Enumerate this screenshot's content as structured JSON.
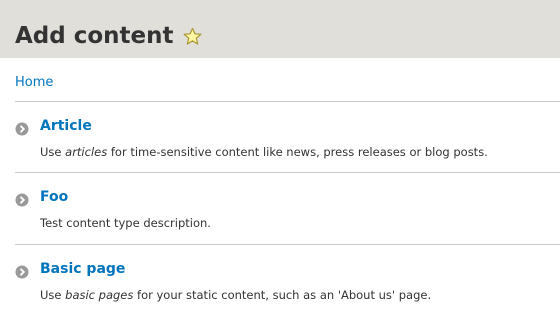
{
  "header": {
    "title": "Add content",
    "shortcut_icon": "star-icon",
    "background": "#e0dfd9"
  },
  "breadcrumb": {
    "home": "Home"
  },
  "link_color": "#0074bd",
  "content_types": [
    {
      "label": "Article",
      "description_before": "Use ",
      "description_em": "articles",
      "description_after": " for time-sensitive content like news, press releases or blog posts."
    },
    {
      "label": "Foo",
      "description_before": "Test content type description.",
      "description_em": "",
      "description_after": ""
    },
    {
      "label": "Basic page",
      "description_before": "Use ",
      "description_em": "basic pages",
      "description_after": " for your static content, such as an 'About us' page."
    }
  ],
  "bullet_icon": "chevron-right-circle-icon"
}
